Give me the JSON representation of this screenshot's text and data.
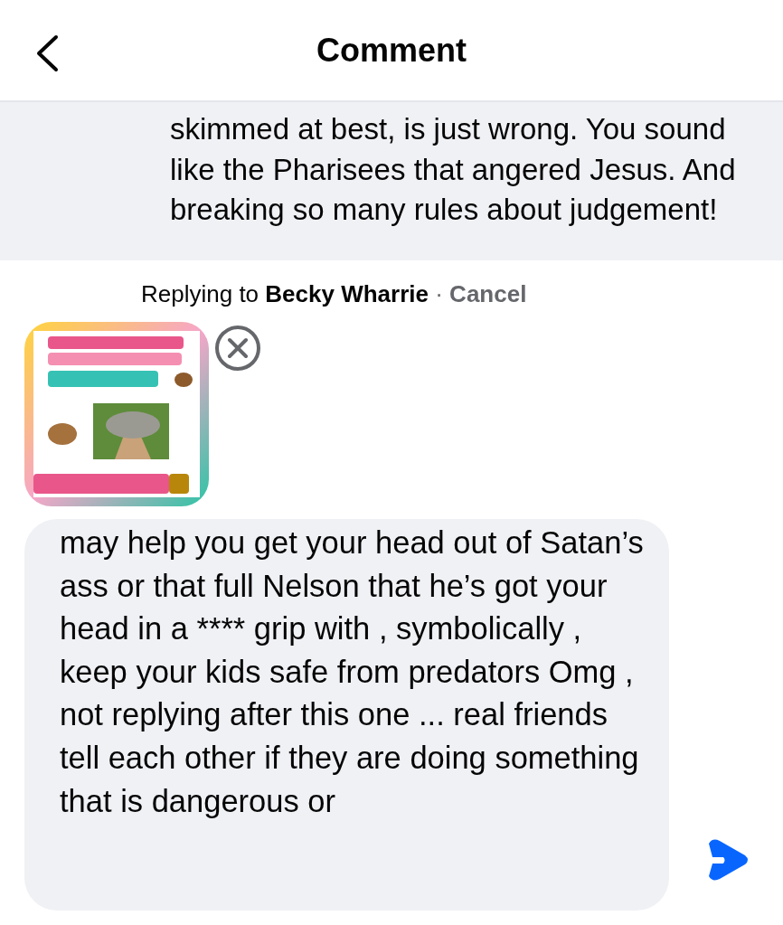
{
  "header": {
    "title": "Comment"
  },
  "comment": {
    "text": "skimmed at best, is just wrong. You sound like the Pharisees that angered Jesus. And breaking so many rules about judgement!"
  },
  "reply_banner": {
    "prefix": "Replying to",
    "name": "Becky Wharrie",
    "separator": "·",
    "cancel": "Cancel"
  },
  "composer": {
    "value": "may help you get your head out of Satan’s ass or that full Nelson that he’s got your head in a **** grip with  , symbolically , keep your kids safe from predators Omg , not replying after this one ... real friends tell each other if they are doing something that is dangerous or"
  }
}
